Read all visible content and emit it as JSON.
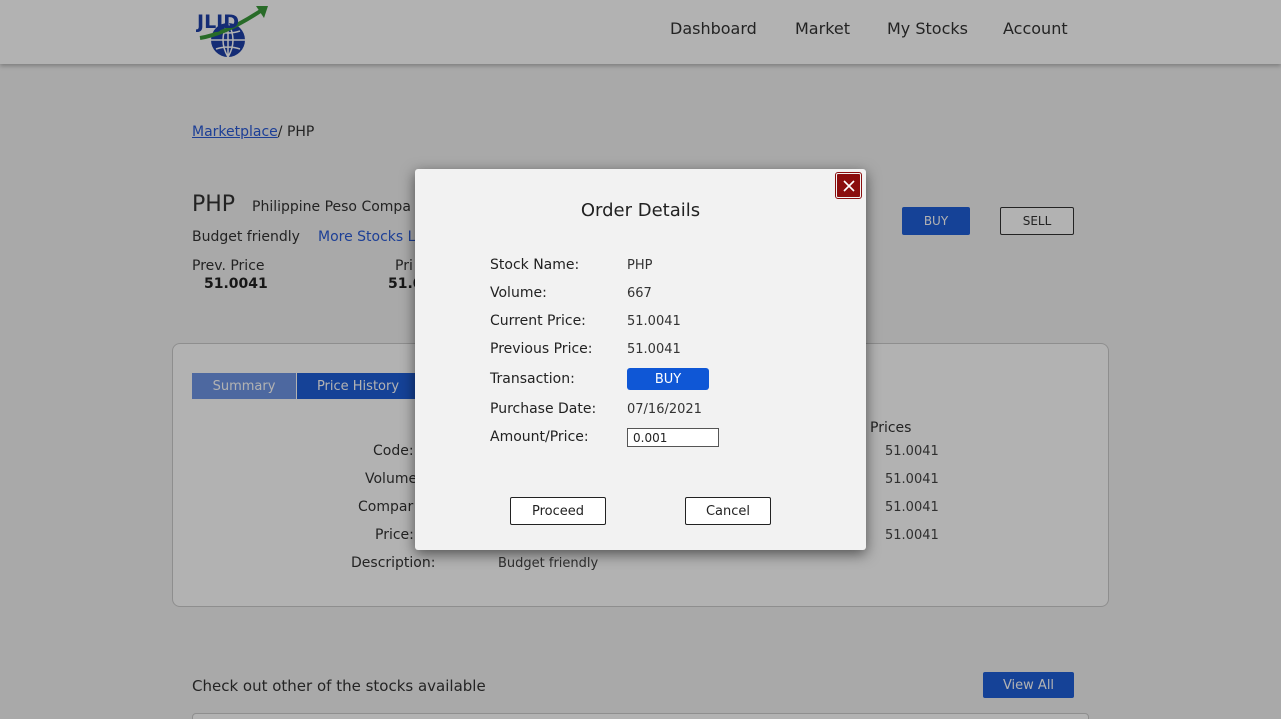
{
  "header": {
    "logo_text": "JLJD",
    "nav": [
      "Dashboard",
      "Market",
      "My Stocks",
      "Account"
    ]
  },
  "breadcrumb": {
    "link": "Marketplace",
    "current": "/ PHP"
  },
  "stock": {
    "code": "PHP",
    "company": "Philippine Peso Compa",
    "description": "Budget friendly",
    "more_link": "More Stocks L",
    "prev_price_label": "Prev. Price",
    "prev_price_value": "51.0041",
    "price_label": "Pri",
    "price_value": "51.0"
  },
  "actions": {
    "buy": "BUY",
    "sell": "SELL"
  },
  "tabs": [
    "Summary",
    "Price History"
  ],
  "details": {
    "labels": [
      "Code:",
      "Volume",
      "Compar",
      "Price:",
      "Description:"
    ],
    "description_value": "Budget friendly",
    "prices_header": "Prices",
    "prices": [
      "51.0041",
      "51.0041",
      "51.0041",
      "51.0041"
    ]
  },
  "other": {
    "title": "Check out other of the stocks available",
    "view_all": "View All"
  },
  "modal": {
    "title": "Order Details",
    "rows": [
      {
        "label": "Stock Name:",
        "value": "PHP"
      },
      {
        "label": "Volume:",
        "value": "667"
      },
      {
        "label": "Current Price:",
        "value": "51.0041"
      },
      {
        "label": "Previous Price:",
        "value": "51.0041"
      },
      {
        "label": "Transaction:",
        "value": "BUY"
      },
      {
        "label": "Purchase Date:",
        "value": "07/16/2021"
      },
      {
        "label": "Amount/Price:",
        "value": "0.001"
      }
    ],
    "proceed": "Proceed",
    "cancel": "Cancel"
  },
  "colors": {
    "accent": "#1f5fd8",
    "close": "#8b0d0d"
  },
  "icons": {
    "close": "close-icon",
    "logo": "globe-arrow-logo"
  }
}
